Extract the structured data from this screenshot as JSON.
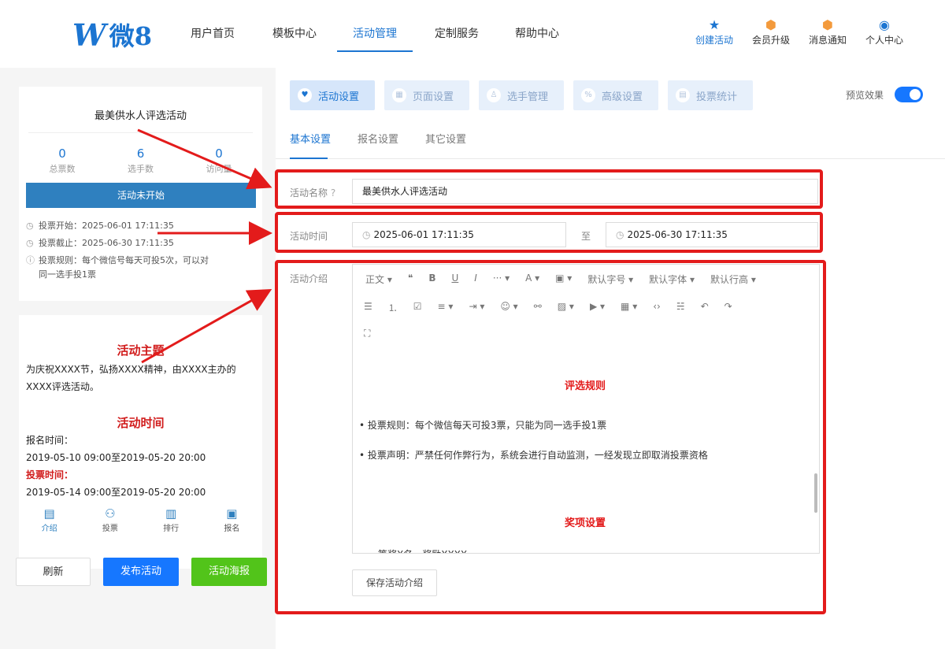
{
  "header": {
    "logo_mark": "W",
    "logo_text": "微8",
    "nav": [
      "用户首页",
      "模板中心",
      "活动管理",
      "定制服务",
      "帮助中心"
    ],
    "active_nav": "活动管理",
    "actions": [
      {
        "icon": "star-icon",
        "label": "创建活动"
      },
      {
        "icon": "vip-badge-icon",
        "label": "会员升级"
      },
      {
        "icon": "bell-badge-icon",
        "label": "消息通知"
      },
      {
        "icon": "user-circle-icon",
        "label": "个人中心"
      }
    ]
  },
  "preview_card": {
    "title": "最美供水人评选活动",
    "stats": [
      {
        "value": "0",
        "label": "总票数"
      },
      {
        "value": "6",
        "label": "选手数"
      },
      {
        "value": "0",
        "label": "访问量"
      }
    ],
    "status": "活动未开始",
    "vote_start": "投票开始：2025-06-01 17:11:35",
    "vote_end": "投票截止：2025-06-30 17:11:35",
    "vote_rule": "投票规则：每个微信号每天可投5次，可以对同一选手投1票"
  },
  "content_card": {
    "theme_heading": "活动主题",
    "theme_text": "为庆祝XXXX节，弘扬XXXX精神，由XXXX主办的XXXX评选活动。",
    "time_heading": "活动时间",
    "signup_label": "报名时间：",
    "signup_range": "2019-05-10 09:00至2019-05-20 20:00",
    "vote_label": "投票时间：",
    "vote_range": "2019-05-14 09:00至2019-05-20 20:00"
  },
  "bottom_tabs": [
    {
      "icon": "intro-icon",
      "label": "介绍"
    },
    {
      "icon": "vote-icon",
      "label": "投票"
    },
    {
      "icon": "rank-icon",
      "label": "排行"
    },
    {
      "icon": "signup-icon",
      "label": "报名"
    }
  ],
  "buttons": {
    "refresh": "刷新",
    "publish": "发布活动",
    "poster": "活动海报"
  },
  "top_tabs": [
    {
      "icon": "heart-icon",
      "label": "活动设置"
    },
    {
      "icon": "page-icon",
      "label": "页面设置"
    },
    {
      "icon": "user-icon",
      "label": "选手管理"
    },
    {
      "icon": "percent-icon",
      "label": "高级设置"
    },
    {
      "icon": "chart-icon",
      "label": "投票统计"
    }
  ],
  "preview_label": "预览效果",
  "sub_tabs": [
    "基本设置",
    "报名设置",
    "其它设置"
  ],
  "form": {
    "name_label": "活动名称",
    "name_value": "最美供水人评选活动",
    "time_label": "活动时间",
    "start_time": "2025-06-01 17:11:35",
    "to": "至",
    "end_time": "2025-06-30 17:11:35",
    "intro_label": "活动介绍"
  },
  "editor": {
    "row1": [
      "正文 ▾",
      "❝",
      "B",
      "U",
      "I",
      "··· ▾",
      "A ▾",
      "▣ ▾",
      "默认字号 ▾",
      "默认字体 ▾",
      "默认行高 ▾"
    ],
    "row2": [
      "☰",
      "⒈",
      "☑",
      "≡ ▾",
      "⇥ ▾",
      "☺ ▾",
      "⚯",
      "▨ ▾",
      "▶ ▾",
      "▦ ▾",
      "‹›",
      "☵",
      "↶",
      "↷"
    ],
    "row3": [
      "⛶"
    ],
    "heading1": "评选规则",
    "p1": "• 投票规则：每个微信每天可投3票，只能为同一选手投1票",
    "p2": "• 投票声明：严禁任何作弊行为，系统会进行自动监测，一经发现立即取消投票资格",
    "heading2": "奖项设置",
    "p3": "一等奖X名，奖励XXXX"
  },
  "save_intro_button": "保存活动介绍",
  "colors": {
    "primary": "#1c75d1",
    "highlight_red": "#e31b1b",
    "green": "#52c41a"
  }
}
